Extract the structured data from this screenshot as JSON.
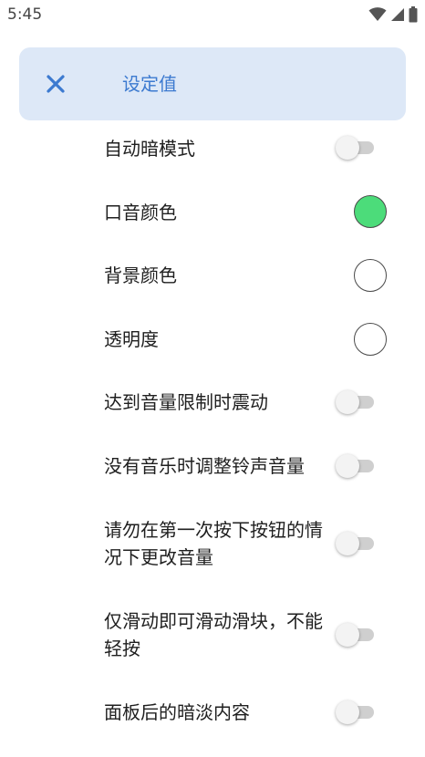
{
  "status_bar": {
    "time": "5:45"
  },
  "header": {
    "title": "设定值",
    "close_icon": "close-icon",
    "background": "#dde8f7",
    "accent": "#3c7ad0"
  },
  "settings": [
    {
      "label": "自动暗模式",
      "control": "toggle",
      "on": false
    },
    {
      "label": "口音颜色",
      "control": "color",
      "color": "#4cdc7a"
    },
    {
      "label": "背景颜色",
      "control": "color",
      "color": "#ffffff"
    },
    {
      "label": "透明度",
      "control": "color",
      "color": "#ffffff"
    },
    {
      "label": "达到音量限制时震动",
      "control": "toggle",
      "on": false
    },
    {
      "label": "没有音乐时调整铃声音量",
      "control": "toggle",
      "on": false
    },
    {
      "label": "请勿在第一次按下按钮的情况下更改音量",
      "control": "toggle",
      "on": false
    },
    {
      "label": "仅滑动即可滑动滑块，不能轻按",
      "control": "toggle",
      "on": false
    },
    {
      "label": "面板后的暗淡内容",
      "control": "toggle",
      "on": false
    }
  ]
}
